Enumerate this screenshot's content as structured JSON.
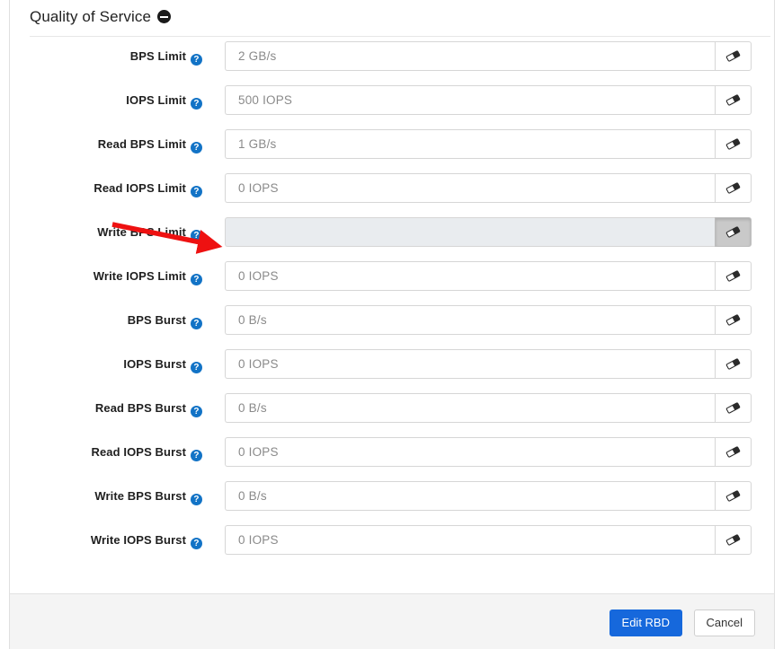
{
  "card": {
    "title": "Quality of Service",
    "collapse_icon": "minus-circle-icon"
  },
  "form": {
    "help_icon_glyph": "?",
    "clear_button_icon": "eraser-icon",
    "fields": [
      {
        "label": "BPS Limit",
        "value": "",
        "placeholder": "2 GB/s",
        "disabled": false,
        "clear_active": false
      },
      {
        "label": "IOPS Limit",
        "value": "",
        "placeholder": "500 IOPS",
        "disabled": false,
        "clear_active": false
      },
      {
        "label": "Read BPS Limit",
        "value": "",
        "placeholder": "1 GB/s",
        "disabled": false,
        "clear_active": false
      },
      {
        "label": "Read IOPS Limit",
        "value": "",
        "placeholder": "0 IOPS",
        "disabled": false,
        "clear_active": false
      },
      {
        "label": "Write BPS Limit",
        "value": "",
        "placeholder": "",
        "disabled": true,
        "clear_active": true
      },
      {
        "label": "Write IOPS Limit",
        "value": "",
        "placeholder": "0 IOPS",
        "disabled": false,
        "clear_active": false
      },
      {
        "label": "BPS Burst",
        "value": "",
        "placeholder": "0 B/s",
        "disabled": false,
        "clear_active": false
      },
      {
        "label": "IOPS Burst",
        "value": "",
        "placeholder": "0 IOPS",
        "disabled": false,
        "clear_active": false
      },
      {
        "label": "Read BPS Burst",
        "value": "",
        "placeholder": "0 B/s",
        "disabled": false,
        "clear_active": false
      },
      {
        "label": "Read IOPS Burst",
        "value": "",
        "placeholder": "0 IOPS",
        "disabled": false,
        "clear_active": false
      },
      {
        "label": "Write BPS Burst",
        "value": "",
        "placeholder": "0 B/s",
        "disabled": false,
        "clear_active": false
      },
      {
        "label": "Write IOPS Burst",
        "value": "",
        "placeholder": "0 IOPS",
        "disabled": false,
        "clear_active": false
      }
    ]
  },
  "footer": {
    "submit_label": "Edit RBD",
    "cancel_label": "Cancel"
  },
  "annotation": {
    "type": "arrow",
    "color": "#ee1111",
    "points_to": "Write BPS Limit"
  },
  "colors": {
    "accent_blue": "#1668dc",
    "help_icon_blue": "#1273c6",
    "disabled_field": "#e9ecef",
    "footer_bg": "#f4f4f4",
    "annotation_red": "#ee1111"
  }
}
